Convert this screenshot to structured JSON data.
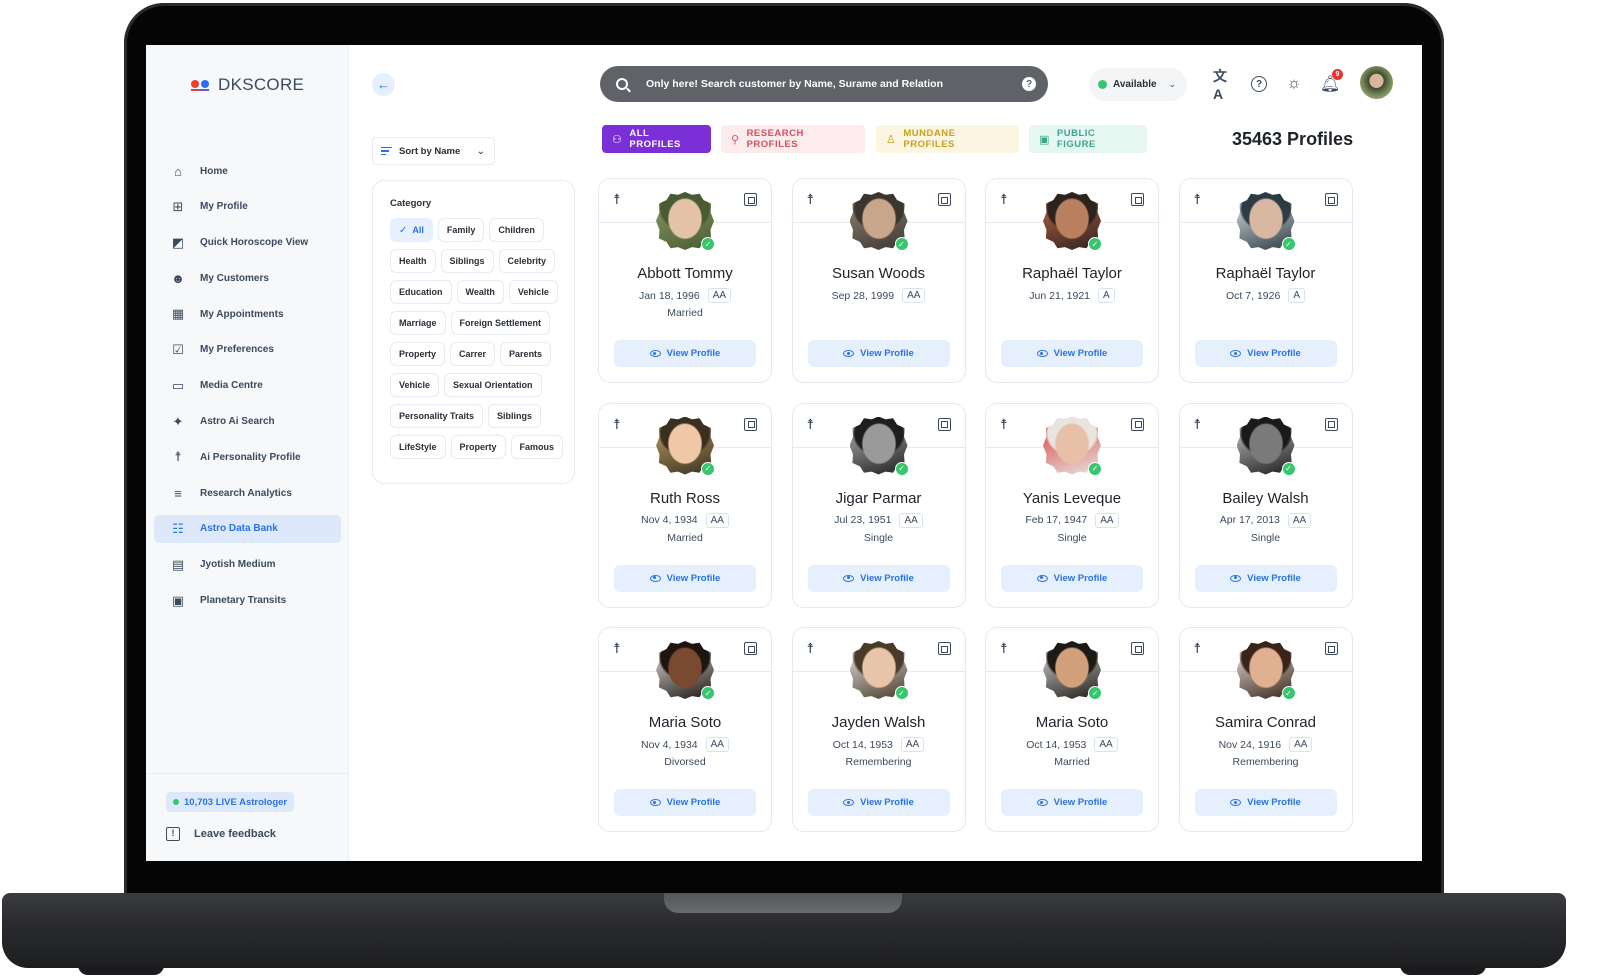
{
  "app": {
    "brand": "DKSCORE"
  },
  "sidebar": {
    "items": [
      {
        "label": "Home",
        "icon": "home-icon",
        "glyph": "⌂",
        "active": false
      },
      {
        "label": "My Profile",
        "icon": "profile-chart-icon",
        "glyph": "⊞",
        "active": false
      },
      {
        "label": "Quick Horoscope View",
        "icon": "horoscope-icon",
        "glyph": "◩",
        "active": false
      },
      {
        "label": "My Customers",
        "icon": "customers-icon",
        "glyph": "☻",
        "active": false
      },
      {
        "label": "My Appointments",
        "icon": "calendar-icon",
        "glyph": "▦",
        "active": false
      },
      {
        "label": "My Preferences",
        "icon": "preferences-icon",
        "glyph": "☑",
        "active": false
      },
      {
        "label": "Media Centre",
        "icon": "clapperboard-icon",
        "glyph": "▭",
        "active": false
      },
      {
        "label": "Astro Ai Search",
        "icon": "sparkle-icon",
        "glyph": "✦",
        "active": false
      },
      {
        "label": "Ai Personality Profile",
        "icon": "person-icon",
        "glyph": "☨",
        "active": false
      },
      {
        "label": "Research Analytics",
        "icon": "research-icon",
        "glyph": "≡",
        "active": false
      },
      {
        "label": "Astro Data Bank",
        "icon": "data-bank-icon",
        "glyph": "☷",
        "active": true
      },
      {
        "label": "Jyotish Medium",
        "icon": "document-icon",
        "glyph": "▤",
        "active": false
      },
      {
        "label": "Planetary Transits",
        "icon": "clipboard-icon",
        "glyph": "▣",
        "active": false
      }
    ],
    "live_badge": "10,703 LIVE Astrologer",
    "feedback_label": "Leave feedback"
  },
  "header": {
    "search_placeholder": "Only here! Search customer by Name, Surame and Relation",
    "help_glyph": "?",
    "status": "Available",
    "notification_count": "9",
    "translate_glyph": "文A",
    "help_icon_glyph": "?",
    "theme_glyph": "☼",
    "bell_glyph": "🔔"
  },
  "toolbar": {
    "sort_label": "Sort by Name",
    "back_glyph": "←",
    "chevron_glyph": "⌄"
  },
  "tabs": [
    {
      "label": "ALL PROFILES",
      "glyph": "⚇",
      "active": true
    },
    {
      "label": "RESEARCH PROFILES",
      "glyph": "⚲",
      "active": false
    },
    {
      "label": "MUNDANE PROFILES",
      "glyph": "♙",
      "active": false
    },
    {
      "label": "PUBLIC FIGURE",
      "glyph": "▣",
      "active": false
    }
  ],
  "profiles_count": "35463 Profiles",
  "category": {
    "title": "Category",
    "chips": [
      {
        "label": "All",
        "active": true
      },
      {
        "label": "Family",
        "active": false
      },
      {
        "label": "Children",
        "active": false
      },
      {
        "label": "Health",
        "active": false
      },
      {
        "label": "Siblings",
        "active": false
      },
      {
        "label": "Celebrity",
        "active": false
      },
      {
        "label": "Education",
        "active": false
      },
      {
        "label": "Wealth",
        "active": false
      },
      {
        "label": "Vehicle",
        "active": false
      },
      {
        "label": "Marriage",
        "active": false
      },
      {
        "label": "Foreign Settlement",
        "active": false
      },
      {
        "label": "Property",
        "active": false
      },
      {
        "label": "Carrer",
        "active": false
      },
      {
        "label": "Parents",
        "active": false
      },
      {
        "label": "Vehicle",
        "active": false
      },
      {
        "label": "Sexual Orientation",
        "active": false
      },
      {
        "label": "Personality Traits",
        "active": false
      },
      {
        "label": "Siblings",
        "active": false
      },
      {
        "label": "LifeStyle",
        "active": false
      },
      {
        "label": "Property",
        "active": false
      },
      {
        "label": "Famous",
        "active": false
      }
    ]
  },
  "cards": [
    {
      "name": "Abbott Tommy",
      "dob": "Jan 18, 1996",
      "rating": "AA",
      "status": "Married",
      "view_label": "View Profile",
      "photo_colors": [
        "#e3c2a5",
        "#4a5a32",
        "#8ea066"
      ]
    },
    {
      "name": "Susan Woods",
      "dob": "Sep 28, 1999",
      "rating": "AA",
      "status": "",
      "view_label": "View Profile",
      "photo_colors": [
        "#c9a58a",
        "#3b3530",
        "#9a8a7a"
      ]
    },
    {
      "name": "Raphaël Taylor",
      "dob": "Jun 21, 1921",
      "rating": "A",
      "status": "",
      "view_label": "View Profile",
      "photo_colors": [
        "#b98060",
        "#2c221e",
        "#c26a4a"
      ]
    },
    {
      "name": "Raphaël Taylor",
      "dob": "Oct 7, 1926",
      "rating": "A",
      "status": "",
      "view_label": "View Profile",
      "photo_colors": [
        "#d8b8a0",
        "#2d3c44",
        "#e9eef0"
      ]
    },
    {
      "name": "Ruth Ross",
      "dob": "Nov 4, 1934",
      "rating": "AA",
      "status": "Married",
      "view_label": "View Profile",
      "photo_colors": [
        "#f0c8a8",
        "#3a3020",
        "#c9a66a"
      ]
    },
    {
      "name": "Jigar Parmar",
      "dob": "Jul 23, 1951",
      "rating": "AA",
      "status": "Single",
      "view_label": "View Profile",
      "photo_colors": [
        "#9a9a9a",
        "#1e1e1e",
        "#bcbcbc"
      ]
    },
    {
      "name": "Yanis Leveque",
      "dob": "Feb 17, 1947",
      "rating": "AA",
      "status": "Single",
      "view_label": "View Profile",
      "photo_colors": [
        "#e8c0a8",
        "#e8e4e0",
        "#d63a3a"
      ]
    },
    {
      "name": "Bailey Walsh",
      "dob": "Apr 17, 2013",
      "rating": "AA",
      "status": "Single",
      "view_label": "View Profile",
      "photo_colors": [
        "#7a7a7a",
        "#1a1a1a",
        "#d0d0d0"
      ]
    },
    {
      "name": "Maria Soto",
      "dob": "Nov 4, 1934",
      "rating": "AA",
      "status": "Divorsed",
      "view_label": "View Profile",
      "photo_colors": [
        "#7a4a30",
        "#1e1410",
        "#f0f0f0"
      ]
    },
    {
      "name": "Jayden Walsh",
      "dob": "Oct 14, 1953",
      "rating": "AA",
      "status": "Remembering",
      "view_label": "View Profile",
      "photo_colors": [
        "#e8c4a8",
        "#4a3a2a",
        "#f2f2f2"
      ]
    },
    {
      "name": "Maria Soto",
      "dob": "Oct 14, 1953",
      "rating": "AA",
      "status": "Married",
      "view_label": "View Profile",
      "photo_colors": [
        "#d2a07a",
        "#1e1a16",
        "#e6e6e6"
      ]
    },
    {
      "name": "Samira Conrad",
      "dob": "Nov 24, 1916",
      "rating": "AA",
      "status": "Remembering",
      "view_label": "View Profile",
      "photo_colors": [
        "#e0b090",
        "#3a2418",
        "#f2f2f2"
      ]
    }
  ],
  "card_icons": {
    "person_glyph": "☨",
    "verified_glyph": "✓"
  }
}
